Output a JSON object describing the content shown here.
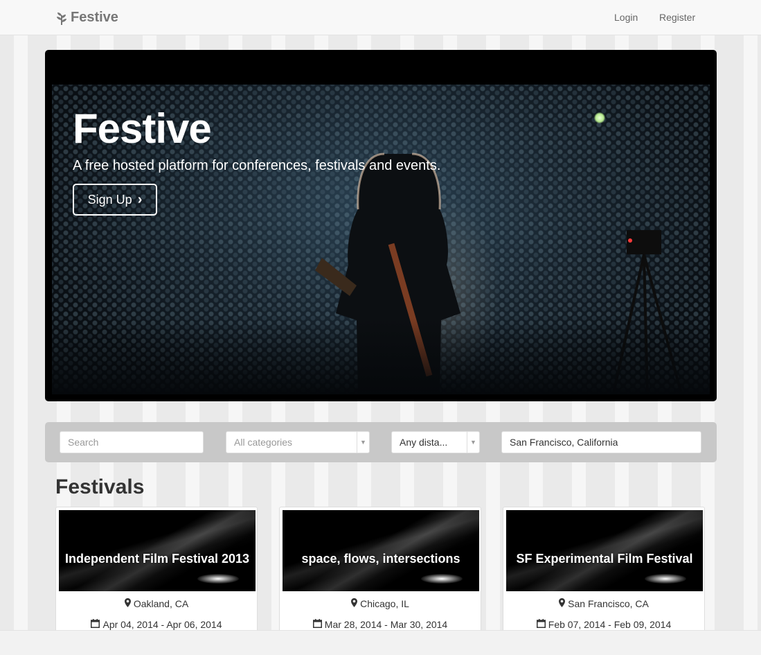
{
  "nav": {
    "brand": "Festive",
    "login": "Login",
    "register": "Register"
  },
  "hero": {
    "title": "Festive",
    "subtitle": "A free hosted platform for conferences, festivals and events.",
    "cta": "Sign Up"
  },
  "filters": {
    "search_placeholder": "Search",
    "category": "All categories",
    "distance": "Any dista...",
    "location": "San Francisco, California"
  },
  "section_title": "Festivals",
  "cards": [
    {
      "title": "Independent Film Festival 2013",
      "location": "Oakland, CA",
      "dates": "Apr 04, 2014 - Apr 06, 2014"
    },
    {
      "title": "space, flows, intersections",
      "location": "Chicago, IL",
      "dates": "Mar 28, 2014 - Mar 30, 2014"
    },
    {
      "title": "SF Experimental Film Festival",
      "location": "San Francisco, CA",
      "dates": "Feb 07, 2014 - Feb 09, 2014"
    }
  ],
  "icons": {
    "brand": "leaf-icon",
    "cta": "chevron-right-icon",
    "location": "map-marker-icon",
    "date": "calendar-icon",
    "dropdown": "caret-down-icon"
  }
}
